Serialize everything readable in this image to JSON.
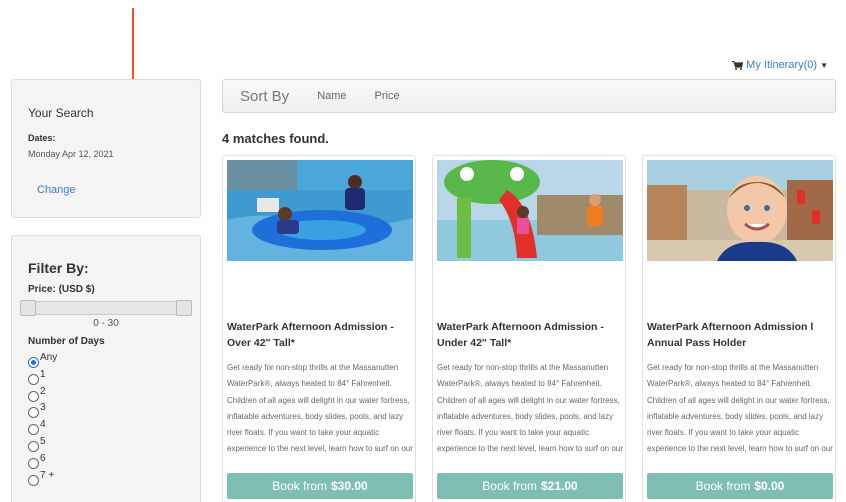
{
  "header": {
    "itinerary_label": "My Itinerary(0)",
    "icons": {
      "cart": "cart-icon",
      "caret": "caret-down-icon"
    }
  },
  "search": {
    "title": "Your Search",
    "dates_label": "Dates:",
    "dates_value": "Monday Apr 12, 2021",
    "change_label": "Change"
  },
  "filter": {
    "title": "Filter By:",
    "price_label": "Price: (USD $)",
    "price_range": "0 - 30",
    "price_min": 0,
    "price_max": 30,
    "days_label": "Number of Days",
    "days_options": [
      "Any",
      "1",
      "2",
      "3",
      "4",
      "5",
      "6",
      "7 +"
    ],
    "days_selected": "Any"
  },
  "sort": {
    "title": "Sort By",
    "options": [
      "Name",
      "Price"
    ]
  },
  "results": {
    "count_text": "4 matches found."
  },
  "cards": [
    {
      "title": "WaterPark Afternoon Admission - Over 42\" Tall*",
      "description": "Get ready for non-stop thrills at the Massanutten WaterPark®, always heated to 84° Fahrenheit. Children of all ages will delight in our water fortress, inflatable adventures, body slides, pools, and lazy river floats. If you want to take your aquatic experience to the next level, learn how to surf on our FlowRider® Endless Wave. No",
      "book_prefix": "Book from",
      "price": "$30.00"
    },
    {
      "title": "WaterPark Afternoon Admission - Under 42\" Tall*",
      "description": "Get ready for non-stop thrills at the Massanutten WaterPark®, always heated to 84° Fahrenheit. Children of all ages will delight in our water fortress, inflatable adventures, body slides, pools, and lazy river floats. If you want to take your aquatic experience to the next level, learn how to surf on our FlowRider® Endless Wave. No",
      "book_prefix": "Book from",
      "price": "$21.00"
    },
    {
      "title": "WaterPark Afternoon Admission l Annual Pass Holder",
      "description": "Get ready for non-stop thrills at the Massanutten WaterPark®, always heated to 84° Fahrenheit. Children of all ages will delight in our water fortress, inflatable adventures, body slides, pools, and lazy river floats. If you want to take your aquatic experience to the next level, learn how to surf on our FlowRider® Endless Wave. No",
      "book_prefix": "Book from",
      "price": "$0.00"
    }
  ],
  "colors": {
    "link": "#3a7dc9",
    "button": "#7fbfb3",
    "annotation_arrow": "#e8551e",
    "radio_selected": "#2b6fd1"
  }
}
